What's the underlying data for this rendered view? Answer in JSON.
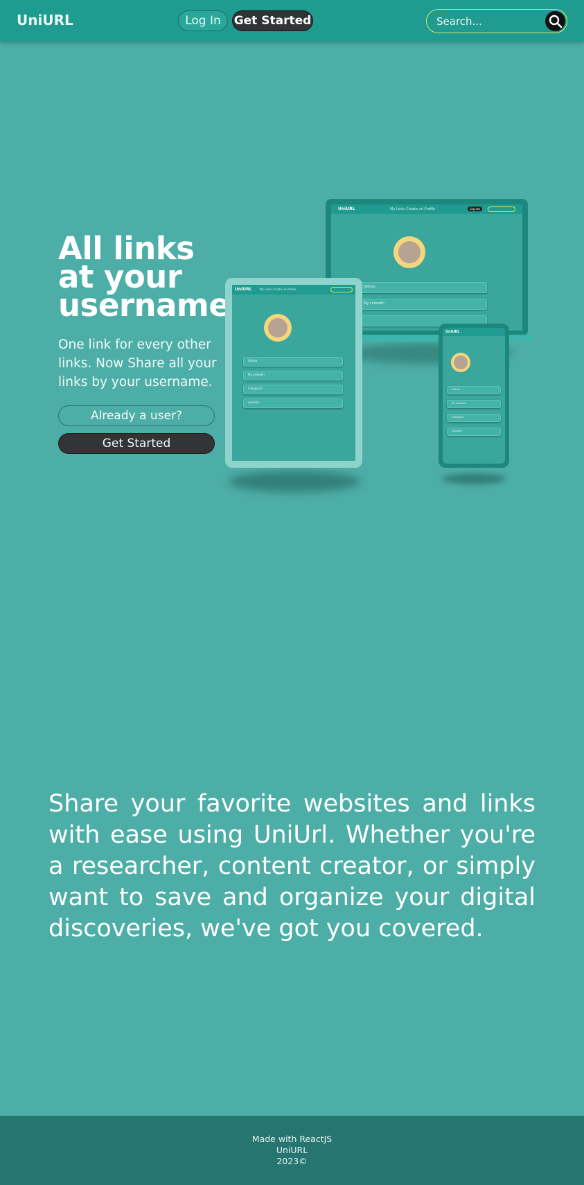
{
  "navbar": {
    "brand": "UniURL",
    "login_label": "Log In",
    "get_started_label": "Get Started",
    "search_placeholder": "Search..."
  },
  "hero": {
    "title_line1": "All links",
    "title_line2": "at your",
    "title_line3": "username.",
    "subtitle": "One link for every other links. Now Share all your links by your username.",
    "already_user_label": "Already a user?",
    "get_started_label": "Get Started"
  },
  "mockup": {
    "brand": "UniURL",
    "nav_links": "My Links   Create url   Profile",
    "logout_label": "Log out",
    "links": [
      "Github",
      "My Linkedin",
      "Instagram",
      "youtube"
    ]
  },
  "description": {
    "text": "Share your favorite websites and links with ease using UniUrl. Whether you're a researcher, content creator, or simply want to save and organize your digital discoveries, we've got you covered."
  },
  "footer": {
    "line1": "Made with ReactJS",
    "line2": "UniURL",
    "line3": "2023©"
  },
  "colors": {
    "page_bg": "#4daea7",
    "navbar_bg": "#1f9b8f",
    "dark_button": "#303436",
    "search_border": "#d8ec5f",
    "footer_bg": "#267570"
  }
}
